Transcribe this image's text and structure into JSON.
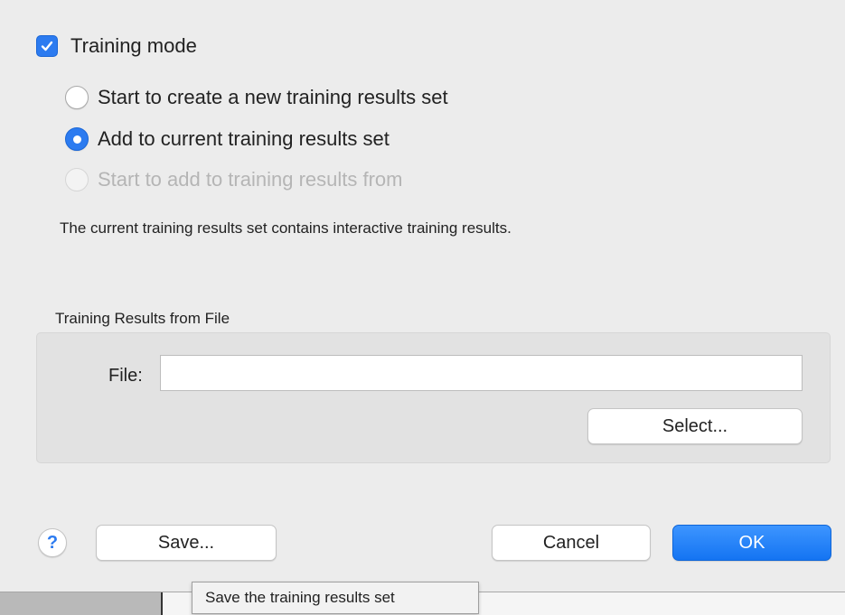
{
  "training_mode": {
    "label": "Training mode",
    "checked": true
  },
  "radio_options": [
    {
      "label": "Start to create a new training results set",
      "checked": false,
      "enabled": true
    },
    {
      "label": "Add to current training results set",
      "checked": true,
      "enabled": true
    },
    {
      "label": "Start to add to training results from",
      "checked": false,
      "enabled": false
    }
  ],
  "info_text": "The current training results set contains interactive training results.",
  "file_group": {
    "title": "Training Results from File",
    "file_label": "File:",
    "file_value": "",
    "select_label": "Select..."
  },
  "buttons": {
    "help": "?",
    "save": "Save...",
    "cancel": "Cancel",
    "ok": "OK"
  },
  "tooltip": "Save the training results set",
  "colors": {
    "accent": "#2c7bf0",
    "background": "#ececec"
  }
}
